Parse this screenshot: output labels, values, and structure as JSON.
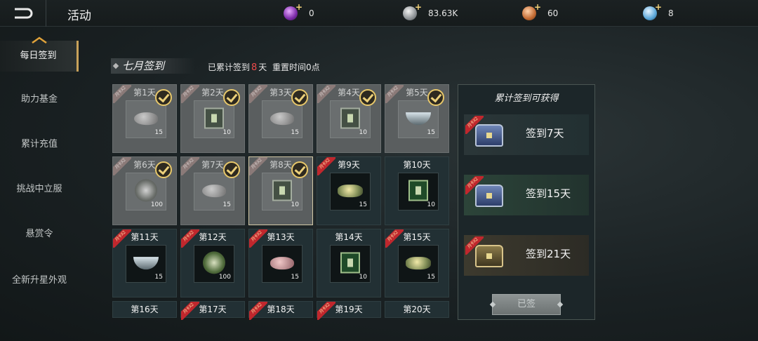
{
  "header": {
    "title": "活动",
    "currencies": [
      {
        "icon": "purple-gem-icon",
        "value": "0"
      },
      {
        "icon": "silver-coin-icon",
        "value": "83.63K"
      },
      {
        "icon": "copper-coin-icon",
        "value": "60"
      },
      {
        "icon": "blue-gem-icon",
        "value": "8"
      }
    ]
  },
  "sidebar": {
    "items": [
      {
        "label": "每日签到"
      },
      {
        "label": "助力基金"
      },
      {
        "label": "累计充值"
      },
      {
        "label": "挑战中立服"
      },
      {
        "label": "悬赏令"
      },
      {
        "label": "全新升星外观"
      }
    ]
  },
  "signin": {
    "month_title": "七月签到",
    "info_prefix": "已累计签到",
    "days_count": "8",
    "info_days_unit": "天",
    "reset_text": "重置时间0点",
    "ribbon_text": "月卡X2"
  },
  "days": [
    {
      "label": "第1天",
      "qty": "15",
      "item": "stone"
    },
    {
      "label": "第2天",
      "qty": "10",
      "item": "book"
    },
    {
      "label": "第3天",
      "qty": "15",
      "item": "ore"
    },
    {
      "label": "第4天",
      "qty": "10",
      "item": "book"
    },
    {
      "label": "第5天",
      "qty": "15",
      "item": "bowl"
    },
    {
      "label": "第6天",
      "qty": "100",
      "item": "medal"
    },
    {
      "label": "第7天",
      "qty": "15",
      "item": "stone"
    },
    {
      "label": "第8天",
      "qty": "10",
      "item": "book"
    },
    {
      "label": "第9天",
      "qty": "15",
      "item": "gold"
    },
    {
      "label": "第10天",
      "qty": "10",
      "item": "book"
    },
    {
      "label": "第11天",
      "qty": "15",
      "item": "bowl"
    },
    {
      "label": "第12天",
      "qty": "100",
      "item": "medal"
    },
    {
      "label": "第13天",
      "qty": "15",
      "item": "pink"
    },
    {
      "label": "第14天",
      "qty": "10",
      "item": "book"
    },
    {
      "label": "第15天",
      "qty": "15",
      "item": "gold"
    },
    {
      "label": "第16天"
    },
    {
      "label": "第17天"
    },
    {
      "label": "第18天"
    },
    {
      "label": "第19天"
    },
    {
      "label": "第20天"
    }
  ],
  "rewards": {
    "title": "累计签到可获得",
    "items": [
      {
        "label": "签到7天"
      },
      {
        "label": "签到15天"
      },
      {
        "label": "签到21天"
      }
    ],
    "button_label": "已签"
  }
}
